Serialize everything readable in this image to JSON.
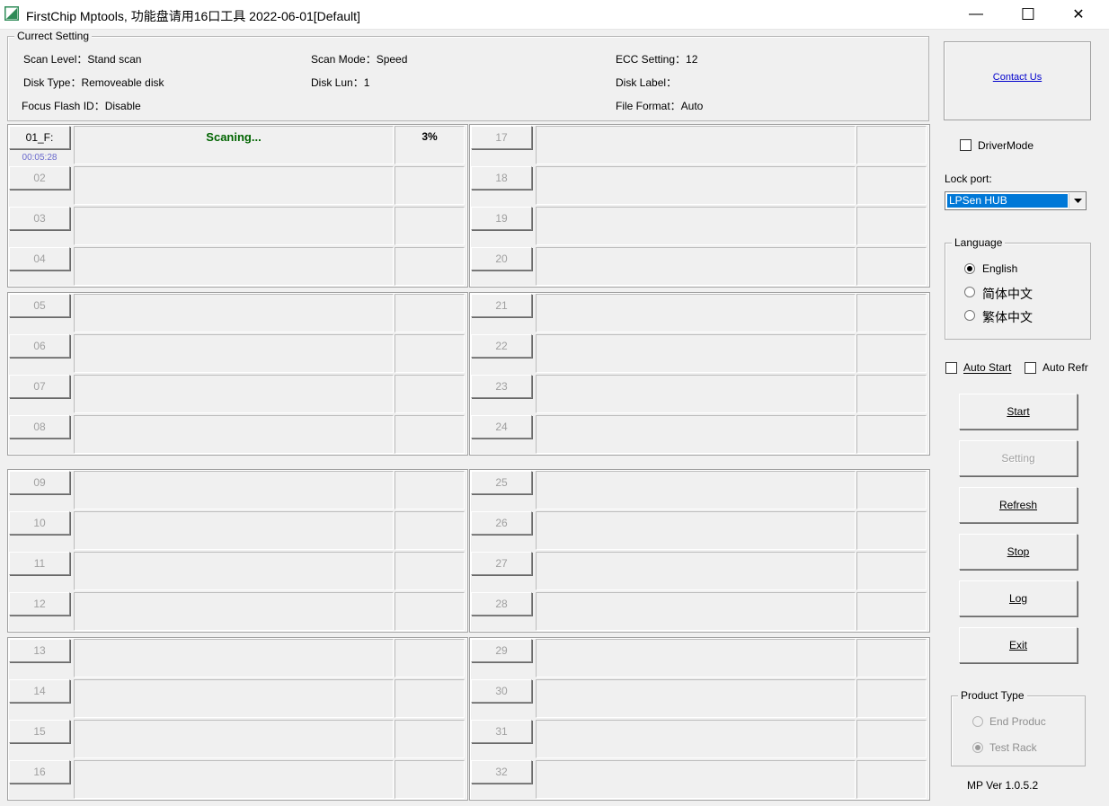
{
  "window": {
    "title": "FirstChip Mptools, 功能盘请用16口工具    2022-06-01[Default]",
    "icon": "app-logo-icon",
    "minimize_glyph": "—",
    "maximize_glyph": "☐",
    "close_glyph": "✕"
  },
  "current_setting": {
    "legend": "Currect Setting",
    "scan_level": "Scan Level：Stand scan",
    "scan_mode": "Scan Mode：Speed",
    "ecc_setting": "ECC Setting：12",
    "disk_type": "Disk Type：Removeable disk",
    "disk_lun": "Disk Lun：1",
    "disk_label": "Disk Label：",
    "focus_flash_id": "Focus Flash ID：Disable",
    "file_format": "File Format：Auto"
  },
  "ports": {
    "active": {
      "label": "01_F:",
      "status": "Scaning...",
      "percent": "3%",
      "timer": "00:05:28"
    },
    "labels": [
      "01_F:",
      "02",
      "03",
      "04",
      "05",
      "06",
      "07",
      "08",
      "09",
      "10",
      "11",
      "12",
      "13",
      "14",
      "15",
      "16",
      "17",
      "18",
      "19",
      "20",
      "21",
      "22",
      "23",
      "24",
      "25",
      "26",
      "27",
      "28",
      "29",
      "30",
      "31",
      "32"
    ]
  },
  "right": {
    "contact_us": "Contact Us",
    "driver_mode": "DriverMode",
    "lock_port_label": "Lock port:",
    "lock_port_value": "LPSen HUB",
    "language": {
      "legend": "Language",
      "options": [
        "English",
        "简体中文",
        "繁体中文"
      ],
      "selected": "English"
    },
    "auto_start": "Auto Start",
    "auto_refresh": "Auto Refr",
    "buttons": {
      "start": "Start",
      "setting": "Setting",
      "refresh": "Refresh",
      "stop": "Stop",
      "log": "Log",
      "exit": "Exit"
    },
    "product_type": {
      "legend": "Product Type",
      "options": [
        "End Produc",
        "Test Rack"
      ],
      "selected": "Test Rack"
    },
    "version": "MP Ver 1.0.5.2"
  },
  "colors": {
    "scanning_text": "#006400",
    "timer_text": "#6a6acd",
    "link": "#0000cc",
    "select_highlight": "#0078d7"
  }
}
